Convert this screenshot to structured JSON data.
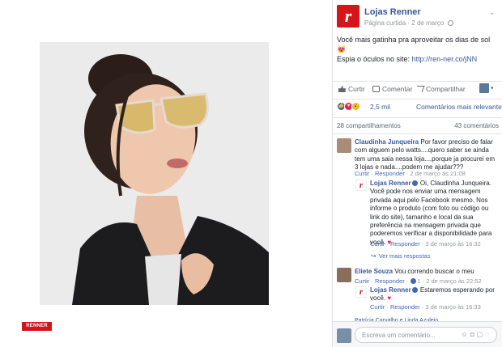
{
  "brand_badge": "RENNER",
  "colors": {
    "brand": "#d6151b",
    "link": "#365899",
    "like": "#4267b2",
    "love": "#e0245e",
    "wow": "#f7b125"
  },
  "post": {
    "page_name": "Lojas Renner",
    "page_type": "Página curtida",
    "date": "2 de março",
    "text_line1": "Você mais gatinha pra aproveitar os dias de sol 😻",
    "text_line2_prefix": "Espia o óculos no site: ",
    "text_link": "http://ren-ner.co/jNN",
    "actions": {
      "like": "Curtir",
      "comment": "Comentar",
      "share": "Compartilhar"
    },
    "reaction_count": "2,5 mil",
    "relevance_filter": "Comentários mais relevantes ▾",
    "shares": "28 compartilhamentos",
    "comments_total": "43 comentários"
  },
  "comments": [
    {
      "author": "Claudinha Junqueira",
      "text": "Por favor preciso de falar com alguem pelo watts....quero saber se ainda tem uma saia nessa loja....porque ja procurei em 3 lojas e nada....podem me ajudar???",
      "like": "Curtir",
      "reply": "Responder",
      "time": "2 de março às 21:08",
      "reply_item": {
        "author": "Lojas Renner",
        "text": "Oi, Claudinha Junqueira. Você pode nos enviar uma mensagem privada aqui pelo Facebook mesmo. Nos informe o produto (com foto ou código ou link do site), tamanho e local da sua preferência na mensagem privada que poderemos verificar a disponibilidade para você.",
        "like": "Curtir",
        "reply": "Responder",
        "time": "3 de março às 16:32"
      }
    },
    {
      "author": "Eliete Souza",
      "text": "Vou correndo buscar o meu",
      "like": "Curtir",
      "reply": "Responder",
      "likes": "1",
      "time": "2 de março às 22:52",
      "reply_item": {
        "author": "Lojas Renner",
        "text": "Estaremos esperando por você.",
        "like": "Curtir",
        "reply": "Responder",
        "time": "3 de março às 16:33"
      }
    }
  ],
  "more_replies": "Ver mais respostas",
  "partial_comment": "Patrícia Carvalho e Linda Azulejo",
  "write_placeholder": "Escreva um comentário..."
}
